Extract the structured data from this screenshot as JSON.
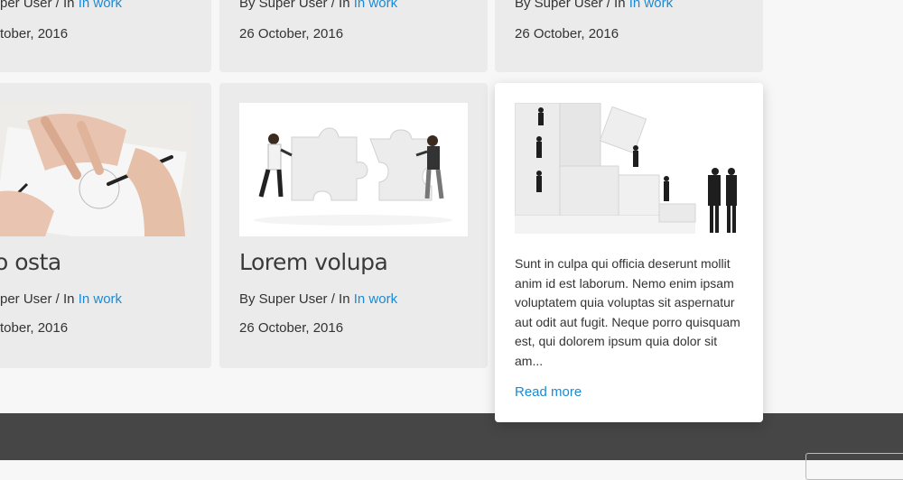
{
  "meta_prefix": "By Super User / In ",
  "meta_prefix_cut": "per User / In ",
  "category": "In work",
  "date": "26 October, 2016",
  "date_cut": "tober, 2016",
  "top_row": {
    "card1": {
      "meta_prefix": "per User / In ",
      "category": "In work",
      "date": "tober, 2016"
    },
    "card2": {
      "meta_prefix": "By Super User / In ",
      "category": "In work",
      "date": "26 October, 2016"
    },
    "card3": {
      "meta_prefix": "By Super User / In ",
      "category": "In work",
      "date": "26 October, 2016"
    }
  },
  "bottom_row": {
    "card1": {
      "title": "o osta",
      "meta_prefix": "per User / In ",
      "category": "In work",
      "date": "tober, 2016",
      "image_icon": "hands-drawing-image"
    },
    "card2": {
      "title": "Lorem volupa",
      "meta_prefix": "By Super User / In ",
      "category": "In work",
      "date": "26 October, 2016",
      "image_icon": "puzzle-push-image"
    },
    "card3": {
      "image_icon": "puzzle-climb-image",
      "excerpt": "Sunt in culpa qui officia deserunt mollit anim id est laborum. Nemo enim ipsam voluptatem quia voluptas sit aspernatur aut odit aut fugit. Neque porro quisquam est, qui dolorem ipsum quia dolor sit am...",
      "read_more": "Read more"
    }
  },
  "colors": {
    "link": "#1a8ad4",
    "card_bg": "#ebebeb",
    "footer_bg": "#464646"
  }
}
